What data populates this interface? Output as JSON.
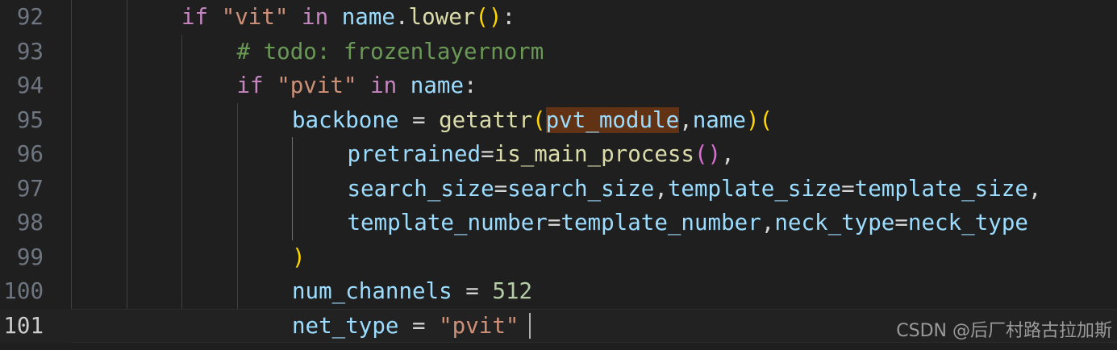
{
  "editor": {
    "active_line": 101,
    "lines": [
      {
        "num": "92",
        "indent": 2,
        "tokens": [
          {
            "t": "if",
            "c": "kw"
          },
          {
            "t": " ",
            "c": "op"
          },
          {
            "t": "\"vit\"",
            "c": "str"
          },
          {
            "t": " ",
            "c": "op"
          },
          {
            "t": "in",
            "c": "kw"
          },
          {
            "t": " ",
            "c": "op"
          },
          {
            "t": "name",
            "c": "var"
          },
          {
            "t": ".",
            "c": "op"
          },
          {
            "t": "lower",
            "c": "fn"
          },
          {
            "t": "()",
            "c": "p1"
          },
          {
            "t": ":",
            "c": "op"
          }
        ]
      },
      {
        "num": "93",
        "indent": 3,
        "tokens": [
          {
            "t": "# todo: frozenlayernorm",
            "c": "com"
          }
        ]
      },
      {
        "num": "94",
        "indent": 3,
        "tokens": [
          {
            "t": "if",
            "c": "kw"
          },
          {
            "t": " ",
            "c": "op"
          },
          {
            "t": "\"pvit\"",
            "c": "str"
          },
          {
            "t": " ",
            "c": "op"
          },
          {
            "t": "in",
            "c": "kw"
          },
          {
            "t": " ",
            "c": "op"
          },
          {
            "t": "name",
            "c": "var"
          },
          {
            "t": ":",
            "c": "op"
          }
        ]
      },
      {
        "num": "95",
        "indent": 4,
        "tokens": [
          {
            "t": "backbone",
            "c": "var"
          },
          {
            "t": " = ",
            "c": "op"
          },
          {
            "t": "getattr",
            "c": "fn"
          },
          {
            "t": "(",
            "c": "p1"
          },
          {
            "t": "pvt_module",
            "c": "var",
            "hl": true
          },
          {
            "t": ",",
            "c": "op"
          },
          {
            "t": "name",
            "c": "var"
          },
          {
            "t": ")",
            "c": "p1"
          },
          {
            "t": "(",
            "c": "p1"
          }
        ]
      },
      {
        "num": "96",
        "indent": 5,
        "tokens": [
          {
            "t": "pretrained",
            "c": "var"
          },
          {
            "t": "=",
            "c": "op"
          },
          {
            "t": "is_main_process",
            "c": "fn"
          },
          {
            "t": "()",
            "c": "p2"
          },
          {
            "t": ",",
            "c": "op"
          }
        ]
      },
      {
        "num": "97",
        "indent": 5,
        "tokens": [
          {
            "t": "search_size",
            "c": "var"
          },
          {
            "t": "=",
            "c": "op"
          },
          {
            "t": "search_size",
            "c": "var"
          },
          {
            "t": ",",
            "c": "op"
          },
          {
            "t": "template_size",
            "c": "var"
          },
          {
            "t": "=",
            "c": "op"
          },
          {
            "t": "template_size",
            "c": "var"
          },
          {
            "t": ",",
            "c": "op"
          }
        ]
      },
      {
        "num": "98",
        "indent": 5,
        "tokens": [
          {
            "t": "template_number",
            "c": "var"
          },
          {
            "t": "=",
            "c": "op"
          },
          {
            "t": "template_number",
            "c": "var"
          },
          {
            "t": ",",
            "c": "op"
          },
          {
            "t": "neck_type",
            "c": "var"
          },
          {
            "t": "=",
            "c": "op"
          },
          {
            "t": "neck_type",
            "c": "var"
          }
        ]
      },
      {
        "num": "99",
        "indent": 4,
        "tokens": [
          {
            "t": ")",
            "c": "p1"
          }
        ]
      },
      {
        "num": "100",
        "indent": 4,
        "tokens": [
          {
            "t": "num_channels",
            "c": "var"
          },
          {
            "t": " = ",
            "c": "op"
          },
          {
            "t": "512",
            "c": "num"
          }
        ]
      },
      {
        "num": "101",
        "indent": 4,
        "tokens": [
          {
            "t": "net_type",
            "c": "var"
          },
          {
            "t": " = ",
            "c": "op"
          },
          {
            "t": "\"pvit\"",
            "c": "str"
          }
        ]
      }
    ]
  },
  "watermark": "CSDN @后厂村路古拉加斯"
}
